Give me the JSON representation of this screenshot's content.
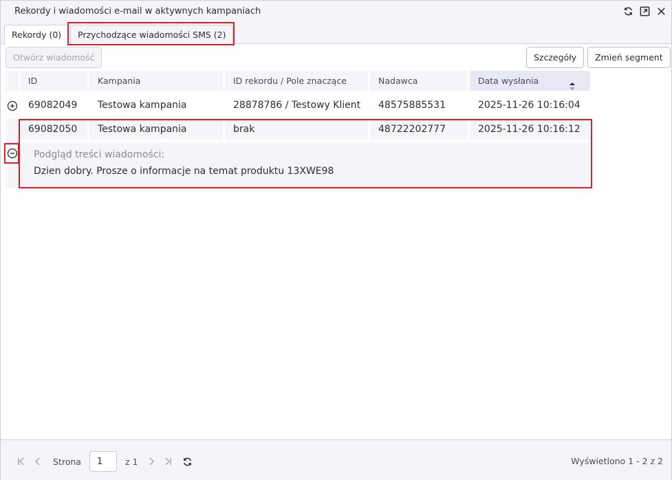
{
  "window": {
    "title": "Rekordy i wiadomości e-mail w aktywnych kampaniach",
    "icons": [
      "refresh-icon",
      "popout-icon",
      "close-icon"
    ]
  },
  "tabs": [
    {
      "label": "Rekordy (0)",
      "active": false
    },
    {
      "label": "Przychodzące wiadomości SMS (2)",
      "active": true
    }
  ],
  "toolbar": {
    "open_label": "Otwórz wiadomość",
    "details_label": "Szczegóły",
    "segment_label": "Zmień segment"
  },
  "table": {
    "columns": [
      "ID",
      "Kampania",
      "ID rekordu / Pole znaczące",
      "Nadawca",
      "Data wysłania"
    ],
    "sorted_column": "Data wysłania",
    "rows": [
      {
        "id": "69082049",
        "campaign": "Testowa kampania",
        "record": "28878786 / Testowy Klient",
        "sender": "48575885531",
        "date": "2025-11-26 10:16:04",
        "expanded": false
      },
      {
        "id": "69082050",
        "campaign": "Testowa kampania",
        "record": "brak",
        "sender": "48722202777",
        "date": "2025-11-26 10:16:12",
        "expanded": true
      }
    ],
    "detail": {
      "label": "Podgląd treści wiadomości:",
      "text": "Dzien dobry. Prosze o informacje na temat produktu 13XWE98"
    }
  },
  "pager": {
    "page_label": "Strona",
    "page_value": "1",
    "of_label": "z 1",
    "displayed": "Wyświetlono 1 - 2 z 2"
  },
  "colors": {
    "highlight": "#d42027",
    "panel": "#f4f4f9"
  }
}
